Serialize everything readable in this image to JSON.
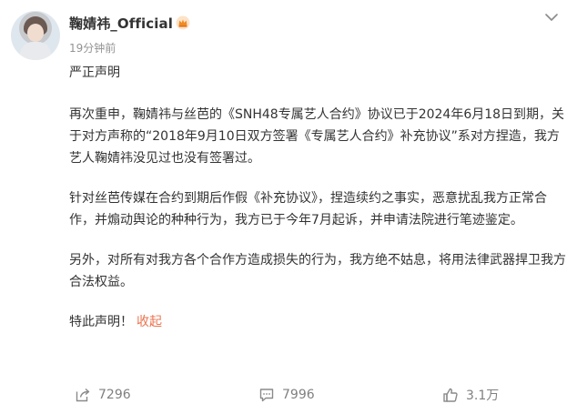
{
  "post": {
    "username": "鞠婧祎_Official",
    "timestamp": "19分钟前",
    "badge_icon": "crown-icon",
    "title": "严正声明",
    "paragraphs": [
      "再次重申，鞠婧祎与丝芭的《SNH48专属艺人合约》协议已于2024年6月18日到期，关于对方声称的“2018年9月10日双方签署《专属艺人合约》补充协议”系对方捏造，我方艺人鞠婧祎没见过也没有签署过。",
      "针对丝芭传媒在合约到期后作假《补充协议》，捏造续约之事实，恶意扰乱我方正常合作，并煽动舆论的种种行为，我方已于今年7月起诉，并申请法院进行笔迹鉴定。",
      "另外，对所有对我方各个合作方造成损失的行为，我方绝不姑息，将用法律武器捍卫我方合法权益。"
    ],
    "closing": "特此声明！",
    "fold_label": "收起"
  },
  "actions": {
    "share_count": "7296",
    "comment_count": "7996",
    "like_count": "3.1万"
  },
  "colors": {
    "text": "#333333",
    "muted": "#939393",
    "accent": "#eb7350",
    "action": "#808080"
  }
}
